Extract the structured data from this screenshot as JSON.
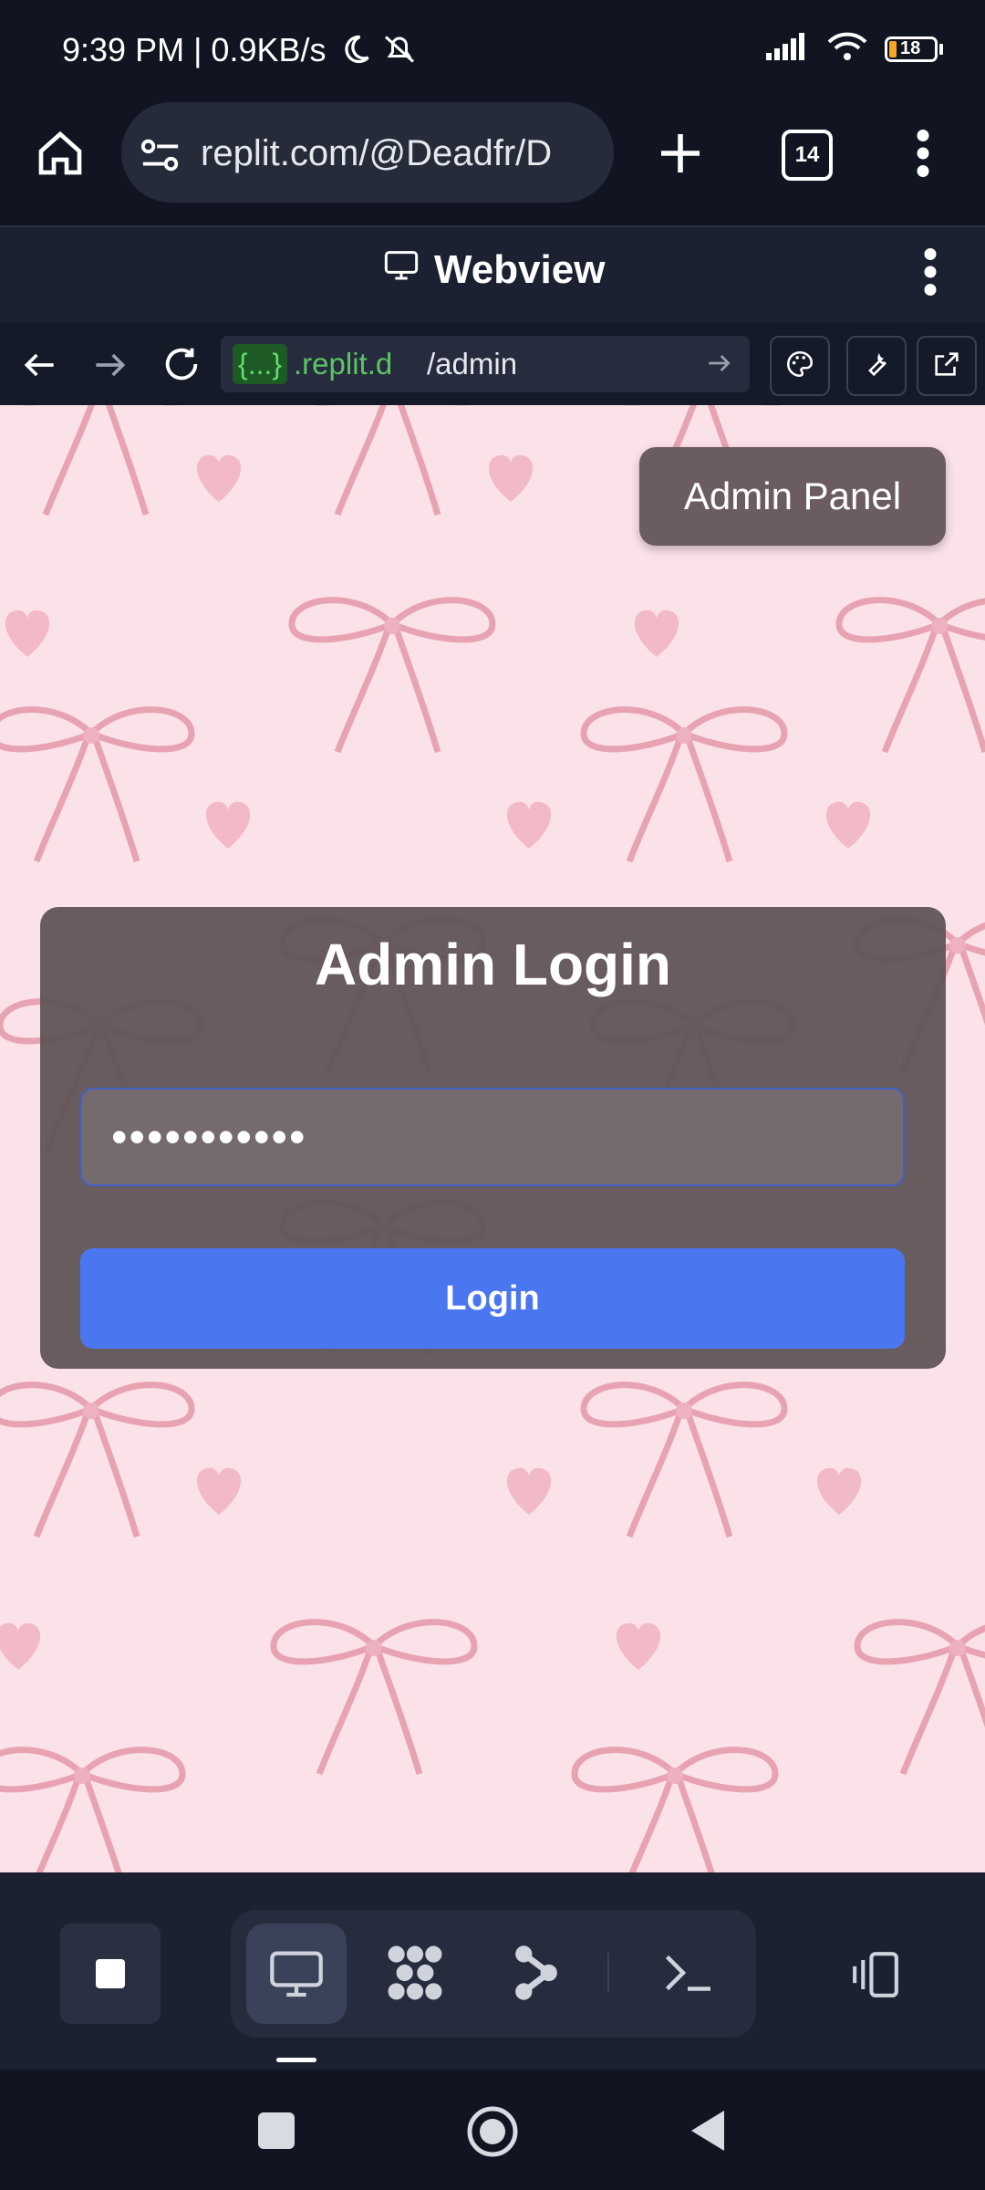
{
  "status_bar": {
    "time": "9:39 PM | 0.9KB/s",
    "battery": "18"
  },
  "browser": {
    "url": "replit.com/@Deadfr/D",
    "tab_count": "14"
  },
  "webview_header": {
    "title": "Webview"
  },
  "nav": {
    "address_tag": "{...}",
    "address_domain": ".replit.d",
    "address_path": "/admin"
  },
  "page": {
    "admin_panel_label": "Admin Panel",
    "login_title": "Admin Login",
    "password_value": "•••••••••••",
    "login_button": "Login"
  },
  "colors": {
    "accent": "#4a77f0",
    "background": "#fbe2e8",
    "card": "#605456"
  }
}
